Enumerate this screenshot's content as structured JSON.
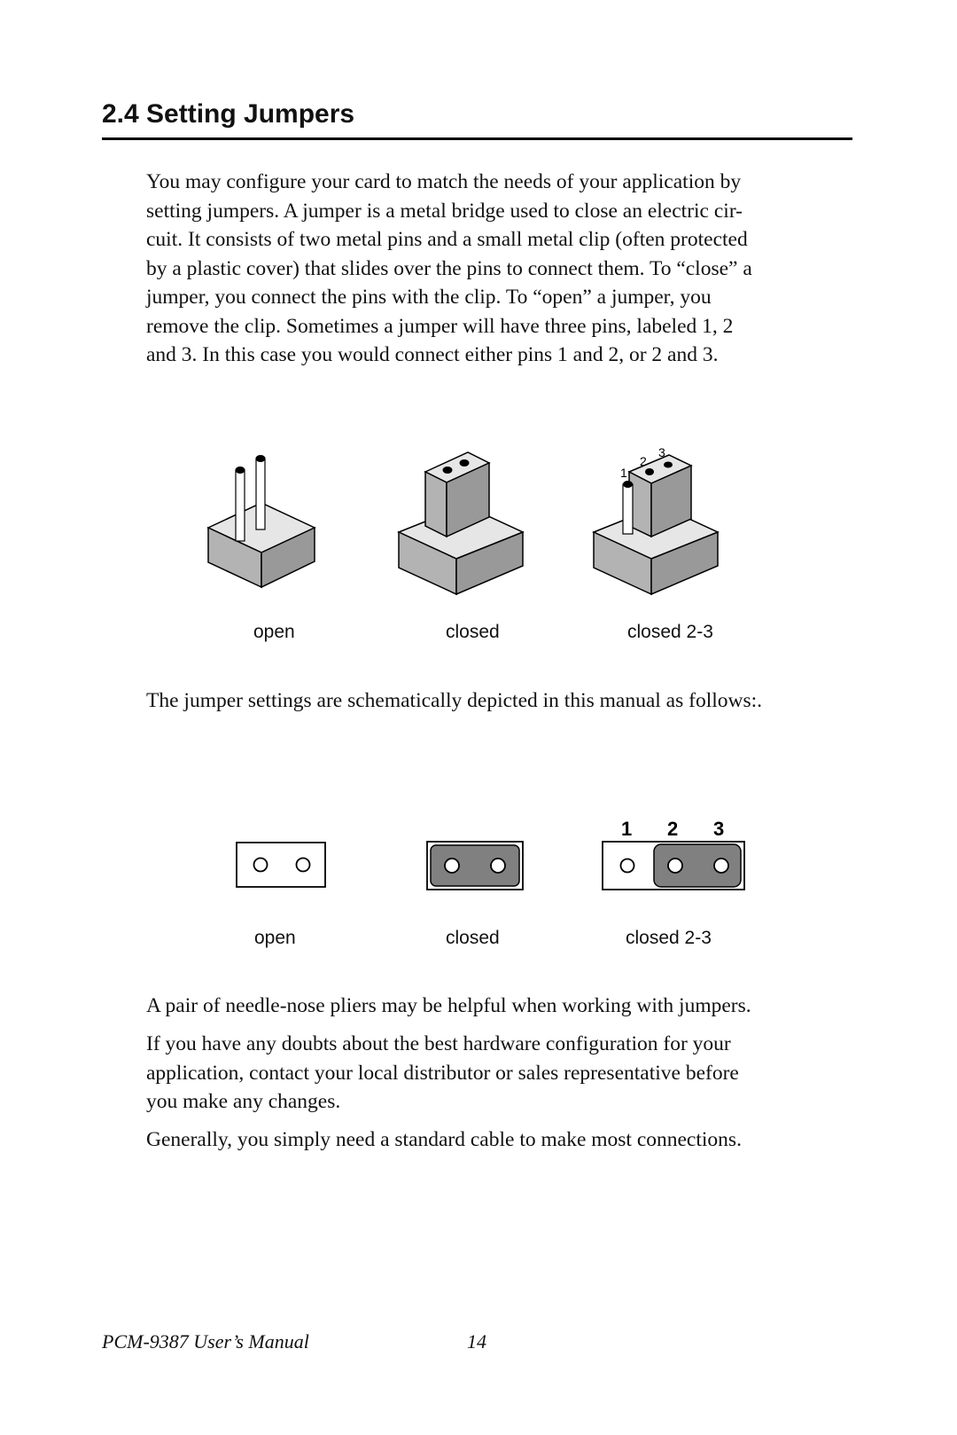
{
  "heading": "2.4  Setting Jumpers",
  "intro_lines": [
    "You may configure your card to match the needs of your application by",
    "setting jumpers. A jumper is a metal bridge used to close an  electric cir-",
    "cuit. It consists of two metal pins and a small metal clip (often protected",
    "by a plastic cover) that slides over the pins to connect them. To “close” a",
    "jumper, you connect the pins with the clip. To “open” a jumper, you",
    "remove the clip. Sometimes a jumper will have three pins, labeled 1, 2",
    "and 3. In this case you would connect either pins 1 and 2, or 2 and 3."
  ],
  "illustrations": {
    "captions": [
      "open",
      "closed",
      "closed 2-3"
    ],
    "pin_labels": [
      "1",
      "2",
      "3"
    ]
  },
  "schematic_intro": "The jumper settings are schematically depicted in this manual as follows:.",
  "schematics": {
    "captions": [
      "open",
      "closed",
      "closed 2-3"
    ],
    "pin_labels": [
      "1",
      "2",
      "3"
    ]
  },
  "tips": [
    [
      "A pair of needle-nose pliers may be helpful when working with jumpers."
    ],
    [
      "If you have any doubts about the best hardware configuration for your",
      "application, contact your local distributor or sales representative before",
      "you make any changes."
    ],
    [
      "Generally, you simply need a standard cable to make most connections."
    ]
  ],
  "footer": {
    "manual_title": "PCM-9387 User’s Manual",
    "page_number": "14"
  }
}
